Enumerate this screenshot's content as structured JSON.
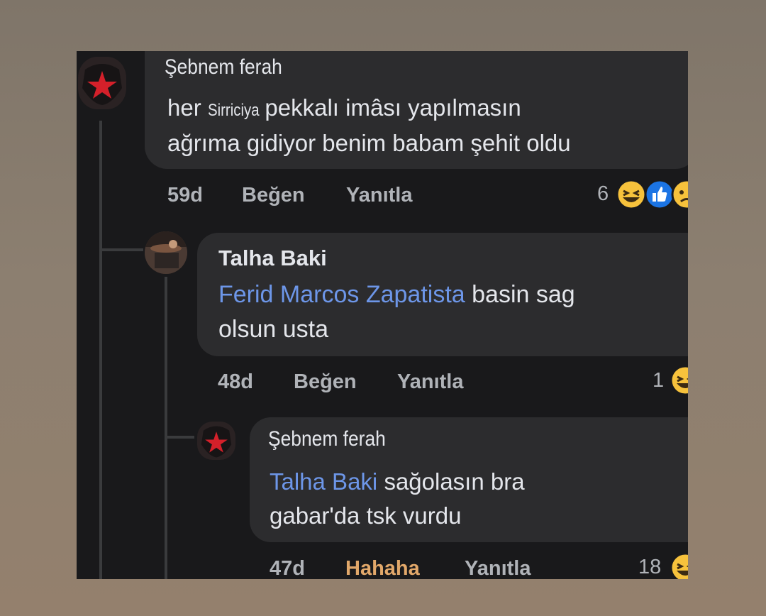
{
  "comments": [
    {
      "author": "Şebnem ferah",
      "text_prefix": "her",
      "text_small": "Sirriciya",
      "text_line1_rest": "pekkalı imâsı yapılmasın",
      "text_line2": "ağrıma gidiyor benim babam şehit oldu",
      "time": "59d",
      "like_label": "Beğen",
      "reply_label": "Yanıtla",
      "reaction_count": "6"
    },
    {
      "author": "Talha Baki",
      "mention": "Ferid Marcos Zapatista",
      "text_line1_rest": "basin sag",
      "text_line2": "olsun usta",
      "time": "48d",
      "like_label": "Beğen",
      "reply_label": "Yanıtla",
      "reaction_count": "1"
    },
    {
      "author": "Şebnem ferah",
      "mention": "Talha Baki",
      "text_line1_rest": "sağolasın bra",
      "text_line2": "gabar'da tsk vurdu",
      "time": "47d",
      "like_label": "Hahaha",
      "reply_label": "Yanıtla",
      "reaction_count": "18"
    }
  ],
  "colors": {
    "mention": "#6d96e8",
    "hahaha_active": "#e2a86a",
    "bubble": "#2c2c2e",
    "panel": "#19191b"
  },
  "icons": [
    "laugh-reaction-icon",
    "like-reaction-icon",
    "sad-reaction-icon",
    "red-star-avatar-icon"
  ]
}
